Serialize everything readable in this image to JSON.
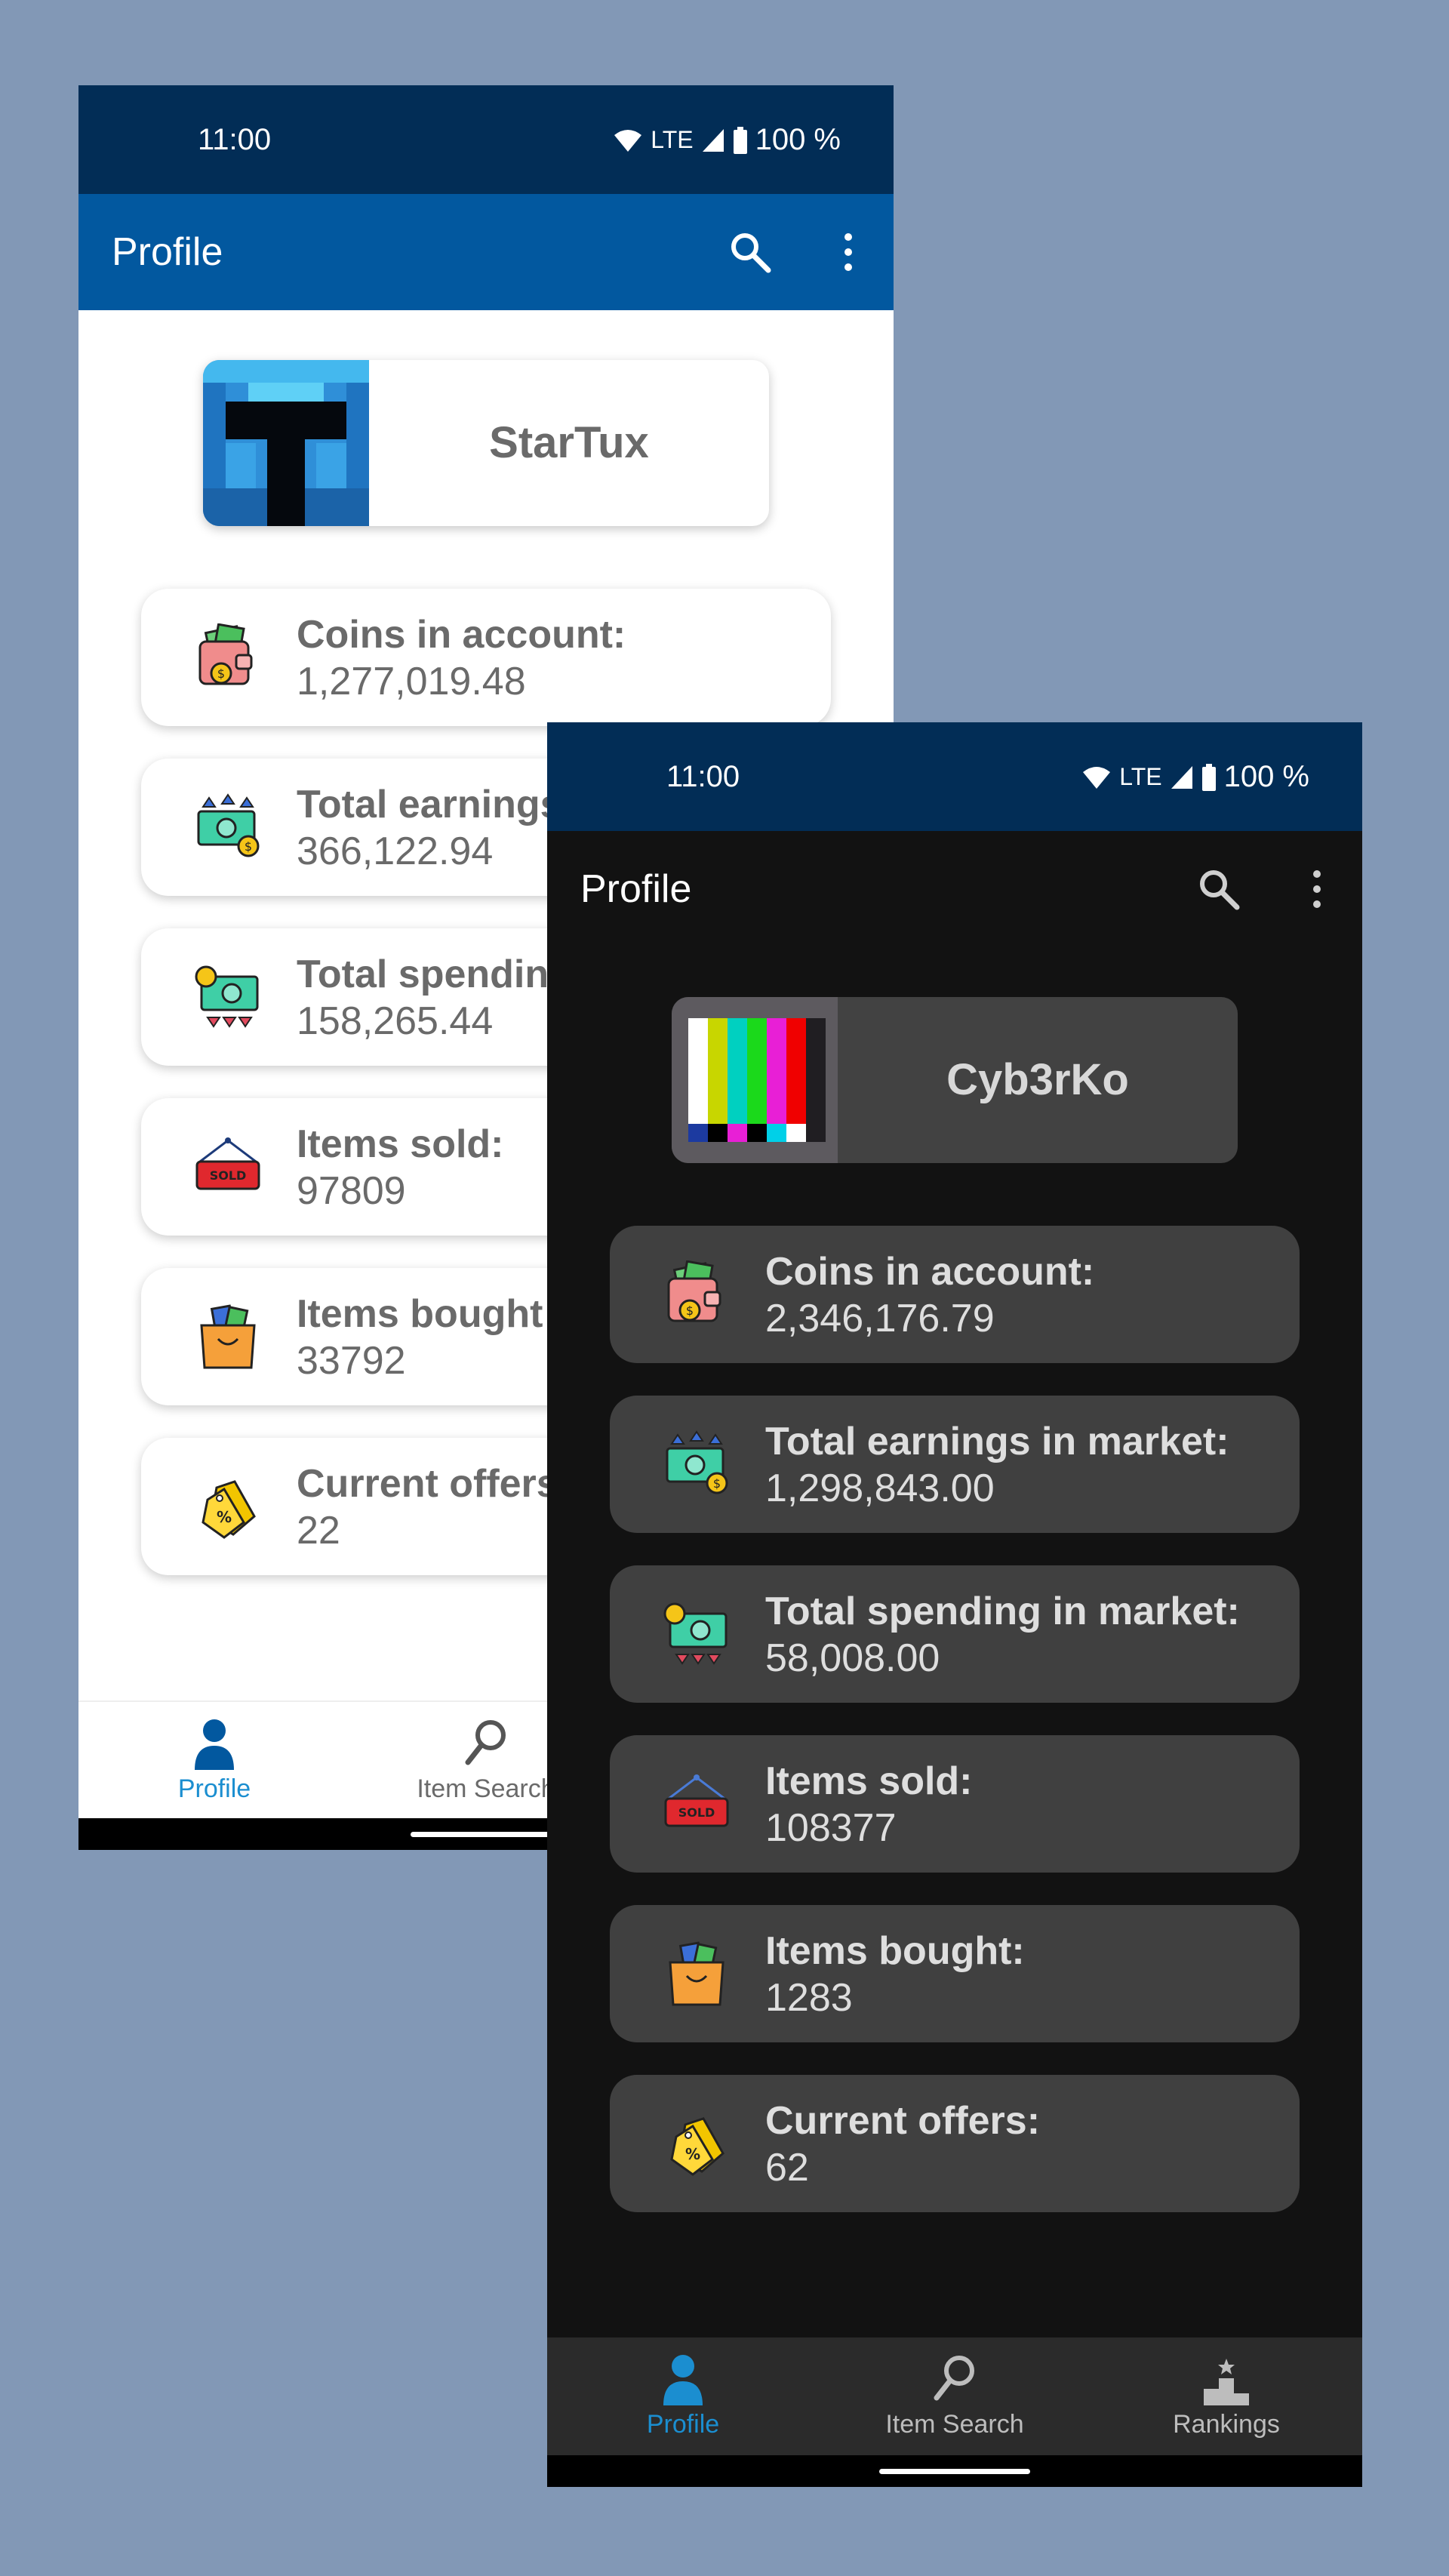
{
  "colors": {
    "background": "#8298b6",
    "status_bar": "#022d56",
    "app_bar_light": "#02589f",
    "app_bar_dark": "#121212",
    "accent": "#1b8ed0"
  },
  "light": {
    "status": {
      "time": "11:00",
      "network": "LTE",
      "battery": "100 %"
    },
    "app_bar": {
      "title": "Profile",
      "icons": [
        "search-icon",
        "more-vert-icon"
      ]
    },
    "user": {
      "name": "StarTux",
      "avatar": "helmet-avatar"
    },
    "stats": [
      {
        "label": "Coins in account:",
        "value": "1,277,019.48",
        "icon": "wallet-icon"
      },
      {
        "label": "Total earnings",
        "value": "366,122.94",
        "icon": "money-up-icon"
      },
      {
        "label": "Total spendin",
        "value": "158,265.44",
        "icon": "money-down-icon"
      },
      {
        "label": "Items sold:",
        "value": "97809",
        "icon": "sold-sign-icon"
      },
      {
        "label": "Items bought",
        "value": "33792",
        "icon": "shopping-bag-icon"
      },
      {
        "label": "Current offers",
        "value": "22",
        "icon": "discount-tag-icon"
      }
    ],
    "nav": [
      {
        "label": "Profile",
        "icon": "person-icon",
        "active": true
      },
      {
        "label": "Item Search",
        "icon": "magnifier-icon",
        "active": false
      }
    ]
  },
  "dark": {
    "status": {
      "time": "11:00",
      "network": "LTE",
      "battery": "100 %"
    },
    "app_bar": {
      "title": "Profile",
      "icons": [
        "search-icon",
        "more-vert-icon"
      ]
    },
    "user": {
      "name": "Cyb3rKo",
      "avatar": "test-pattern-avatar"
    },
    "stats": [
      {
        "label": "Coins in account:",
        "value": "2,346,176.79",
        "icon": "wallet-icon"
      },
      {
        "label": "Total earnings in market:",
        "value": "1,298,843.00",
        "icon": "money-up-icon"
      },
      {
        "label": "Total spending in market:",
        "value": "58,008.00",
        "icon": "money-down-icon"
      },
      {
        "label": "Items sold:",
        "value": "108377",
        "icon": "sold-sign-icon"
      },
      {
        "label": "Items bought:",
        "value": "1283",
        "icon": "shopping-bag-icon"
      },
      {
        "label": "Current offers:",
        "value": "62",
        "icon": "discount-tag-icon"
      }
    ],
    "nav": [
      {
        "label": "Profile",
        "icon": "person-icon",
        "active": true
      },
      {
        "label": "Item Search",
        "icon": "magnifier-icon",
        "active": false
      },
      {
        "label": "Rankings",
        "icon": "podium-icon",
        "active": false
      }
    ]
  },
  "sold_sign_text": "SOLD"
}
